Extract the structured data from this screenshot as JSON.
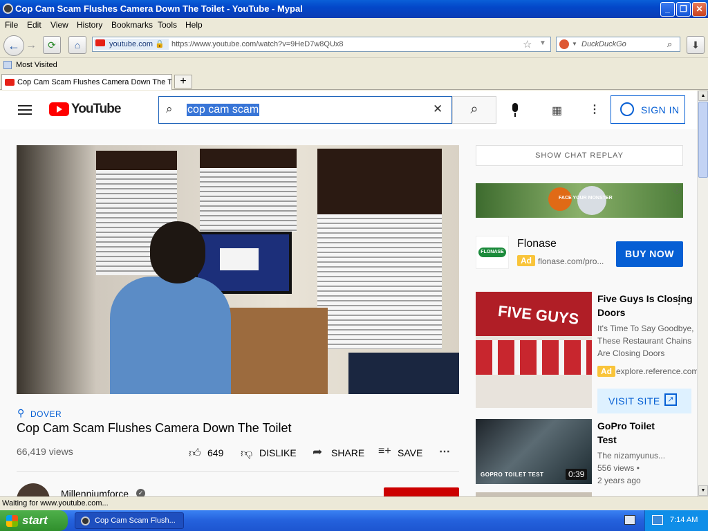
{
  "window": {
    "title": "Cop Cam Scam Flushes Camera Down The Toilet - YouTube - Mypal"
  },
  "menu": [
    "File",
    "Edit",
    "View",
    "History",
    "Bookmarks",
    "Tools",
    "Help"
  ],
  "urlbar": {
    "site": "youtube.com",
    "url": "https://www.youtube.com/watch?v=9HeD7w8QUx8"
  },
  "searchbar": {
    "placeholder": "DuckDuckGo"
  },
  "bookmarks": {
    "most_visited": "Most Visited"
  },
  "tab": {
    "label": "Cop Cam Scam Flushes Camera Down The T..."
  },
  "youtube": {
    "logo": "YouTube",
    "search_value": "cop cam scam",
    "sign_in": "SIGN IN",
    "location": "DOVER",
    "video_title": "Cop Cam Scam Flushes Camera Down The Toilet",
    "views": "66,419 views",
    "likes": "649",
    "dislike": "DISLIKE",
    "share": "SHARE",
    "save": "SAVE",
    "channel": "Millenniumforce",
    "show_chat": "SHOW CHAT REPLAY",
    "banner_text": "FACE YOUR MONSTER",
    "ad": {
      "brand": "Flonase",
      "brand_logo": "FLONASE",
      "badge": "Ad",
      "domain": "flonase.com/pro...",
      "cta": "BUY NOW"
    },
    "ad2": {
      "title": "Five Guys Is Closing Doors",
      "desc": "It's Time To Say Goodbye, These Restaurant Chains Are Closing Doors",
      "badge": "Ad",
      "domain": "explore.reference.com",
      "cta": "VISIT SITE",
      "thumb_text": "FIVE GUYS"
    },
    "rec1": {
      "title": "GoPro Toilet Test",
      "channel": "The nizamyunus...",
      "views": "556 views •",
      "age": "2 years ago",
      "duration": "0:39",
      "thumb_text": "GOPRO TOILET TEST"
    }
  },
  "status": {
    "text": "Waiting for www.youtube.com..."
  },
  "taskbar": {
    "start": "start",
    "task": "Cop Cam Scam Flush...",
    "time": "7:14 AM"
  },
  "colors": {
    "yt_red": "#ff0000",
    "yt_blue": "#065fd4",
    "xp_blue": "#0a5fd8"
  }
}
